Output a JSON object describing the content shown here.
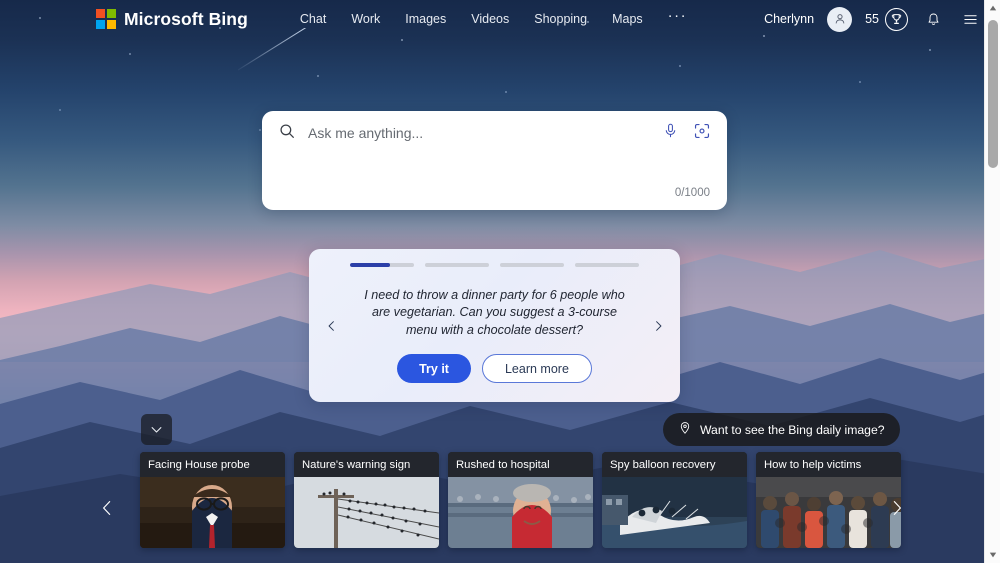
{
  "header": {
    "brand": "Microsoft Bing",
    "logo_colors": {
      "q1": "#f25022",
      "q2": "#7fba00",
      "q3": "#00a4ef",
      "q4": "#ffb900"
    },
    "nav": [
      {
        "label": "Chat"
      },
      {
        "label": "Work"
      },
      {
        "label": "Images"
      },
      {
        "label": "Videos"
      },
      {
        "label": "Shopping"
      },
      {
        "label": "Maps"
      }
    ],
    "more_label": "···",
    "user_name": "Cherlynn",
    "rewards_count": "55"
  },
  "search": {
    "placeholder": "Ask me anything...",
    "value": "",
    "char_count": "0/1000"
  },
  "suggestion": {
    "progress": {
      "total": 4,
      "active_index": 0,
      "active_fill_percent": 62,
      "active_color": "#2b3fa8",
      "track_color": "#cdd0d8"
    },
    "prompt": "I need to throw a dinner party for 6 people who are vegetarian. Can you suggest a 3-course menu with a chocolate dessert?",
    "try_label": "Try it",
    "learn_label": "Learn more",
    "primary_color": "#2b56e0"
  },
  "daily_image": {
    "label": "Want to see the Bing daily image?"
  },
  "news": {
    "cards": [
      {
        "title": "Facing House probe",
        "thumb": "man-in-suit-glasses-hearing"
      },
      {
        "title": "Nature's warning sign",
        "thumb": "birds-on-power-lines"
      },
      {
        "title": "Rushed to hospital",
        "thumb": "man-red-shirt-stadium"
      },
      {
        "title": "Spy balloon recovery",
        "thumb": "balloon-debris-at-sea"
      },
      {
        "title": "How to help victims",
        "thumb": "crowd-of-people"
      }
    ]
  },
  "background": {
    "description": "twilight mountain range with pink sky",
    "sky_top": "#16294a",
    "sky_pink": "#f3bcc3",
    "mountain": "#4c5f8e"
  }
}
